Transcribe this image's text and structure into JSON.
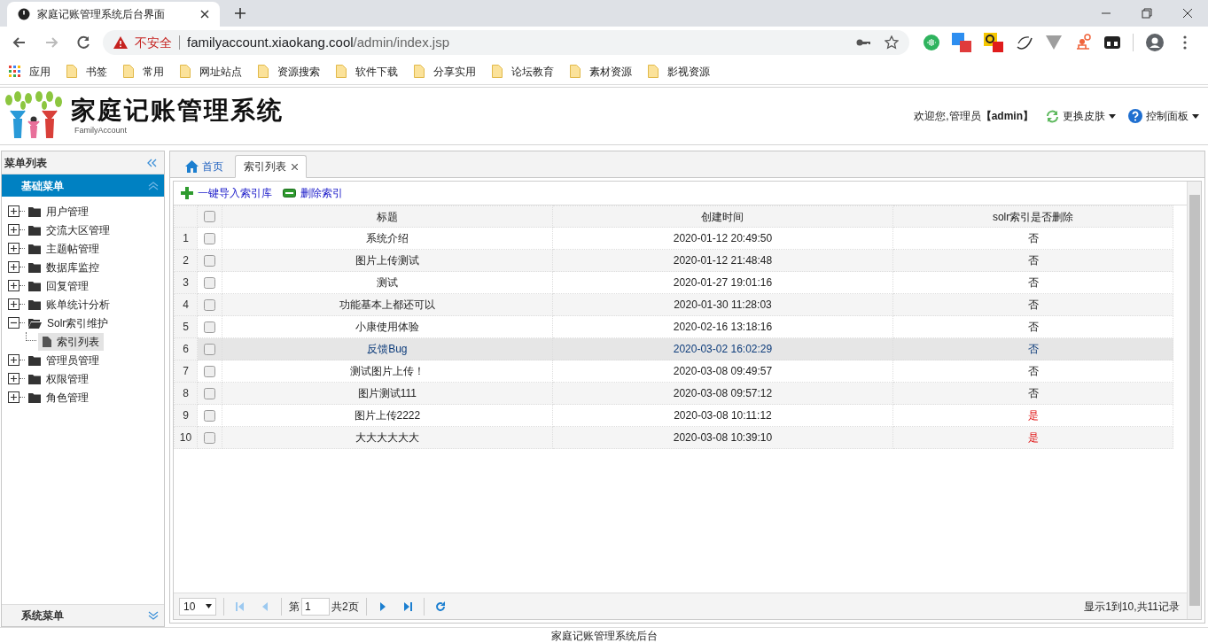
{
  "browser": {
    "tab_title": "家庭记账管理系统后台界面",
    "security_label": "不安全",
    "url_host": "familyaccount.xiaokang.cool",
    "url_path": "/admin/index.jsp",
    "bookmarks": [
      {
        "kind": "apps",
        "label": "应用"
      },
      {
        "kind": "folder",
        "label": "书签"
      },
      {
        "kind": "folder",
        "label": "常用"
      },
      {
        "kind": "folder",
        "label": "网址站点"
      },
      {
        "kind": "folder",
        "label": "资源搜索"
      },
      {
        "kind": "folder",
        "label": "软件下载"
      },
      {
        "kind": "folder",
        "label": "分享实用"
      },
      {
        "kind": "folder",
        "label": "论坛教育"
      },
      {
        "kind": "folder",
        "label": "素材资源"
      },
      {
        "kind": "folder",
        "label": "影视资源"
      }
    ]
  },
  "header": {
    "title": "家庭记账管理系统",
    "subtitle": "FamilyAccount",
    "welcome": "欢迎您,管理员",
    "user": "【admin】",
    "skin_menu": "更换皮肤",
    "control_panel": "控制面板"
  },
  "sidebar": {
    "title": "菜单列表",
    "sections": [
      {
        "label": "基础菜单",
        "expanded": true
      },
      {
        "label": "系统菜单",
        "expanded": false
      }
    ],
    "tree": [
      {
        "label": "用户管理",
        "expanded": false
      },
      {
        "label": "交流大区管理",
        "expanded": false
      },
      {
        "label": "主题帖管理",
        "expanded": false
      },
      {
        "label": "数据库监控",
        "expanded": false
      },
      {
        "label": "回复管理",
        "expanded": false
      },
      {
        "label": "账单统计分析",
        "expanded": false
      },
      {
        "label": "Solr索引维护",
        "expanded": true,
        "children": [
          {
            "label": "索引列表",
            "selected": true
          }
        ]
      },
      {
        "label": "管理员管理",
        "expanded": false
      },
      {
        "label": "权限管理",
        "expanded": false
      },
      {
        "label": "角色管理",
        "expanded": false
      }
    ]
  },
  "tabs": [
    {
      "label": "首页",
      "kind": "home",
      "selected": false,
      "closable": false
    },
    {
      "label": "索引列表",
      "kind": "page",
      "selected": true,
      "closable": true
    }
  ],
  "toolbar": [
    {
      "kind": "add",
      "label": "一键导入索引库"
    },
    {
      "kind": "remove",
      "label": "删除索引"
    }
  ],
  "table": {
    "all_checked": false,
    "columns": [
      "标题",
      "创建时间",
      "solr索引是否删除"
    ],
    "rows": [
      {
        "number": "1",
        "checked": false,
        "selected": false,
        "title": "系统介绍",
        "created": "2020-01-12 20:49:50",
        "deleted": "否",
        "is_deleted": false
      },
      {
        "number": "2",
        "checked": false,
        "selected": false,
        "title": "图片上传测试",
        "created": "2020-01-12 21:48:48",
        "deleted": "否",
        "is_deleted": false
      },
      {
        "number": "3",
        "checked": false,
        "selected": false,
        "title": "测试",
        "created": "2020-01-27 19:01:16",
        "deleted": "否",
        "is_deleted": false
      },
      {
        "number": "4",
        "checked": false,
        "selected": false,
        "title": "功能基本上都还可以",
        "created": "2020-01-30 11:28:03",
        "deleted": "否",
        "is_deleted": false
      },
      {
        "number": "5",
        "checked": false,
        "selected": false,
        "title": "小康使用体验",
        "created": "2020-02-16 13:18:16",
        "deleted": "否",
        "is_deleted": false
      },
      {
        "number": "6",
        "checked": false,
        "selected": true,
        "title": "反馈Bug",
        "created": "2020-03-02 16:02:29",
        "deleted": "否",
        "is_deleted": false
      },
      {
        "number": "7",
        "checked": false,
        "selected": false,
        "title": "测试图片上传！",
        "created": "2020-03-08 09:49:57",
        "deleted": "否",
        "is_deleted": false
      },
      {
        "number": "8",
        "checked": false,
        "selected": false,
        "title": "图片测试111",
        "created": "2020-03-08 09:57:12",
        "deleted": "否",
        "is_deleted": false
      },
      {
        "number": "9",
        "checked": false,
        "selected": false,
        "title": "图片上传2222",
        "created": "2020-03-08 10:11:12",
        "deleted": "是",
        "is_deleted": true
      },
      {
        "number": "10",
        "checked": false,
        "selected": false,
        "title": "大大大大大大",
        "created": "2020-03-08 10:39:10",
        "deleted": "是",
        "is_deleted": true
      }
    ]
  },
  "pager": {
    "page_size": "10",
    "page_prefix": "第",
    "page": "1",
    "page_total": "共2页",
    "summary": "显示1到10,共11记录"
  },
  "footer": "家庭记账管理系统后台"
}
